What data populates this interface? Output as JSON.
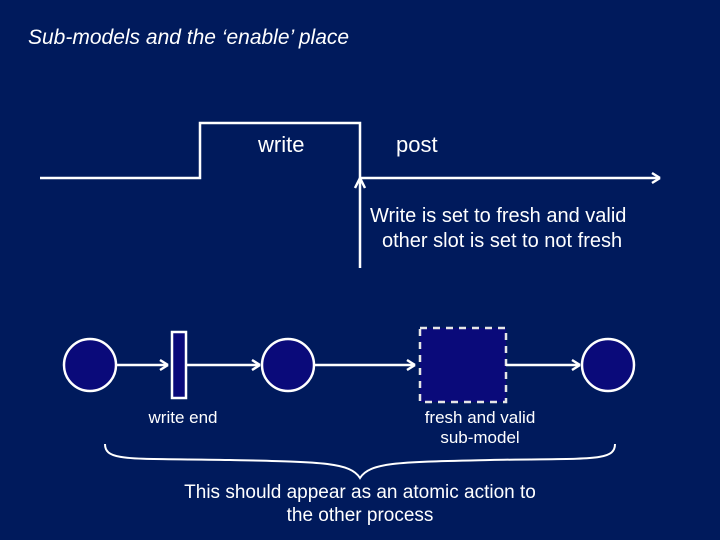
{
  "title": "Sub-models and the ‘enable’ place",
  "timing": {
    "write_label": "write",
    "post_label": "post"
  },
  "description": {
    "line1": "Write is set to fresh and valid",
    "line2": "other slot is set to not fresh"
  },
  "petri": {
    "write_end_label": "write end",
    "fresh_valid_label_line1": "fresh and valid",
    "fresh_valid_label_line2": "sub-model"
  },
  "footer": {
    "line1": "This should appear as an atomic action to",
    "line2": "the other process"
  },
  "colors": {
    "bg": "#001a5c",
    "node_fill": "#0a0a7a",
    "stroke": "#ffffff",
    "dashed": "#e6e6e6"
  }
}
